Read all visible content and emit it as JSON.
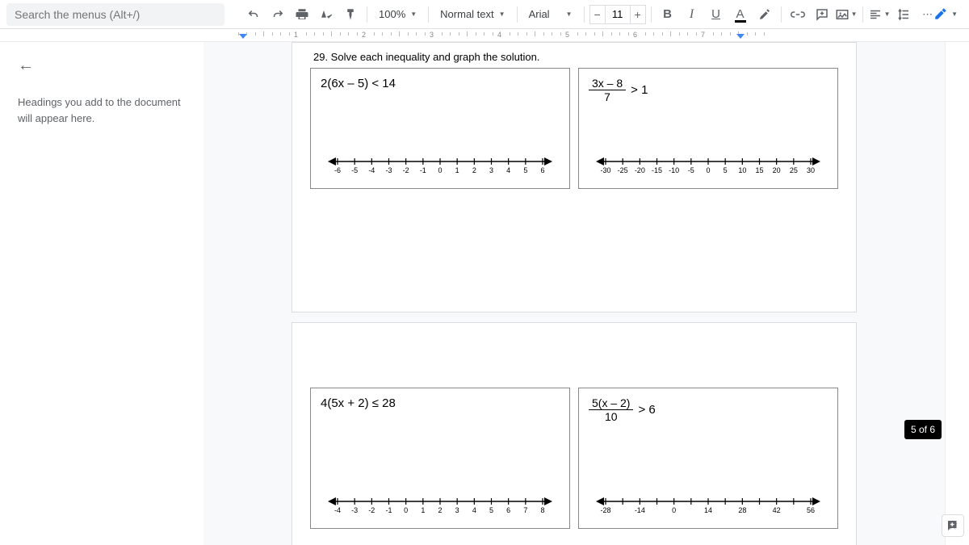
{
  "toolbar": {
    "search_placeholder": "Search the menus (Alt+/)",
    "zoom": "100%",
    "style": "Normal text",
    "font": "Arial",
    "font_size": "11",
    "minus": "−",
    "plus": "+"
  },
  "ruler": {
    "nums": [
      "1",
      "2",
      "3",
      "4",
      "5",
      "6",
      "7"
    ]
  },
  "outline": {
    "message": "Headings you add to the document will appear here."
  },
  "doc": {
    "q_title": "29. Solve each inequality and graph the solution.",
    "cell_a": {
      "expr": "2(6x – 5) < 14"
    },
    "cell_b": {
      "frac_num": "3x – 8",
      "frac_den": "7",
      "rhs": "> 1"
    },
    "cell_c": {
      "expr": "4(5x + 2) ≤ 28"
    },
    "cell_d": {
      "frac_num": "5(x – 2)",
      "frac_den": "10",
      "rhs": "> 6"
    },
    "nl1": [
      "-6",
      "-5",
      "-4",
      "-3",
      "-2",
      "-1",
      "0",
      "1",
      "2",
      "3",
      "4",
      "5",
      "6"
    ],
    "nl2": [
      "-30",
      "-25",
      "-20",
      "-15",
      "-10",
      "-5",
      "0",
      "5",
      "10",
      "15",
      "20",
      "25",
      "30"
    ],
    "nl3": [
      "-4",
      "-3",
      "-2",
      "-1",
      "0",
      "1",
      "2",
      "3",
      "4",
      "5",
      "6",
      "7",
      "8"
    ],
    "nl4": [
      "-28",
      "",
      "-14",
      "",
      "0",
      "",
      "14",
      "",
      "28",
      "",
      "42",
      "",
      "56"
    ]
  },
  "badge": "5 of 6"
}
